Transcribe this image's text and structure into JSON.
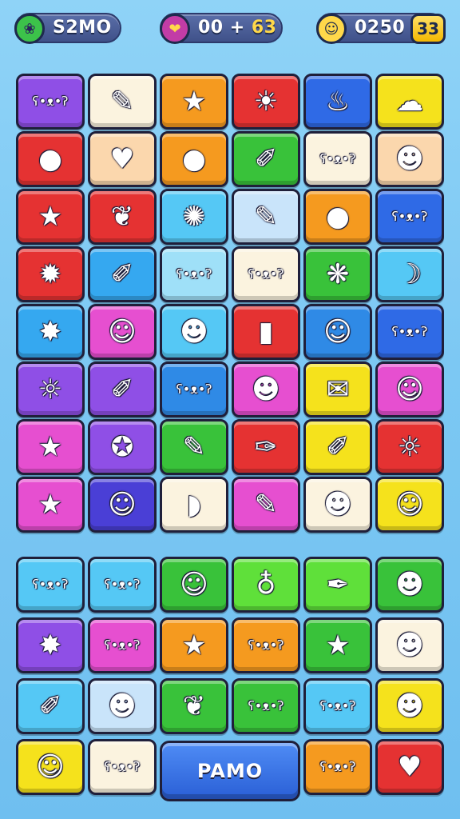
{
  "hud": {
    "coins": {
      "icon": "leaf-coin-icon",
      "value": "S2MO",
      "color": "#3cc24a"
    },
    "moves": {
      "icon": "heart-ribbon-icon",
      "value": "00 + ",
      "accent": "63",
      "color": "#c23ca6"
    },
    "score": {
      "icon": "smiley-icon",
      "value": "0250",
      "badge": "33",
      "color": "#ffd84a"
    }
  },
  "board_top": {
    "rows": [
      [
        {
          "color": "#8f4fe6",
          "glyph": "bear-face-icon"
        },
        {
          "color": "#fbf3df",
          "glyph": "pencil-icon"
        },
        {
          "color": "#f59a1f",
          "glyph": "star-icon"
        },
        {
          "color": "#e53232",
          "glyph": "lion-face-icon"
        },
        {
          "color": "#2f6ae6",
          "glyph": "chili-pepper-icon"
        },
        {
          "color": "#f5e21c",
          "glyph": "ghost-icon"
        }
      ],
      [
        {
          "color": "#e53232",
          "glyph": "fruit-face-icon"
        },
        {
          "color": "#fbd7ad",
          "glyph": "heart-icon"
        },
        {
          "color": "#f59a1f",
          "glyph": "apple-icon"
        },
        {
          "color": "#39c23a",
          "glyph": "crayon-icon"
        },
        {
          "color": "#fbf3df",
          "glyph": "bear-face-icon"
        },
        {
          "color": "#fbd7ad",
          "glyph": "monster-face-icon"
        }
      ],
      [
        {
          "color": "#e53232",
          "glyph": "star-icon"
        },
        {
          "color": "#e53232",
          "glyph": "leaf-icon"
        },
        {
          "color": "#55c8f5",
          "glyph": "yarn-ball-icon"
        },
        {
          "color": "#c9e4fa",
          "glyph": "pencil-icon"
        },
        {
          "color": "#f59a1f",
          "glyph": "cookie-face-icon"
        },
        {
          "color": "#2f6ae6",
          "glyph": "bear-face-icon"
        }
      ],
      [
        {
          "color": "#e53232",
          "glyph": "bomb-icon"
        },
        {
          "color": "#35a8f0",
          "glyph": "crayon-icon"
        },
        {
          "color": "#9fe0f8",
          "glyph": "bear-face-icon"
        },
        {
          "color": "#fbf3df",
          "glyph": "bear-face-icon"
        },
        {
          "color": "#39c23a",
          "glyph": "splash-icon"
        },
        {
          "color": "#55c8f5",
          "glyph": "banana-icon"
        }
      ],
      [
        {
          "color": "#35a8f0",
          "glyph": "splat-icon"
        },
        {
          "color": "#e64fd0",
          "glyph": "hamster-face-icon"
        },
        {
          "color": "#55c8f5",
          "glyph": "blob-face-icon"
        },
        {
          "color": "#e53232",
          "glyph": "battery-icon"
        },
        {
          "color": "#2f8ae6",
          "glyph": "orange-face-icon"
        },
        {
          "color": "#2f6ae6",
          "glyph": "bear-face-icon"
        }
      ],
      [
        {
          "color": "#8f4fe6",
          "glyph": "sun-face-icon"
        },
        {
          "color": "#8f4fe6",
          "glyph": "crayon-icon"
        },
        {
          "color": "#2f8ae6",
          "glyph": "bear-face-icon"
        },
        {
          "color": "#e64fd0",
          "glyph": "whale-face-icon"
        },
        {
          "color": "#f5e21c",
          "glyph": "envelope-icon"
        },
        {
          "color": "#e64fd0",
          "glyph": "cat-face-icon"
        }
      ],
      [
        {
          "color": "#e64fd0",
          "glyph": "star-icon"
        },
        {
          "color": "#8f4fe6",
          "glyph": "star-face-icon"
        },
        {
          "color": "#39c23a",
          "glyph": "pencil-icon"
        },
        {
          "color": "#e53232",
          "glyph": "sparkle-pencil-icon"
        },
        {
          "color": "#f5e21c",
          "glyph": "crayon-icon"
        },
        {
          "color": "#e53232",
          "glyph": "sun-face-icon"
        }
      ],
      [
        {
          "color": "#e64fd0",
          "glyph": "star-icon"
        },
        {
          "color": "#4a3fd6",
          "glyph": "cat-face-icon"
        },
        {
          "color": "#fbf3df",
          "glyph": "pac-face-icon"
        },
        {
          "color": "#e64fd0",
          "glyph": "pencil-icon"
        },
        {
          "color": "#fbf3df",
          "glyph": "tomato-face-icon"
        },
        {
          "color": "#f5e21c",
          "glyph": "hamster-face-icon"
        }
      ]
    ]
  },
  "board_bottom": {
    "rows": [
      [
        {
          "color": "#55c8f5",
          "glyph": "bear-face-icon"
        },
        {
          "color": "#55c8f5",
          "glyph": "bear-face-icon"
        },
        {
          "color": "#39c23a",
          "glyph": "chat-face-icon"
        },
        {
          "color": "#5fe03a",
          "glyph": "balloon-icon"
        },
        {
          "color": "#5fe03a",
          "glyph": "brush-icon"
        },
        {
          "color": "#39c23a",
          "glyph": "blob-face-icon"
        }
      ],
      [
        {
          "color": "#8f4fe6",
          "glyph": "splat-icon"
        },
        {
          "color": "#e64fd0",
          "glyph": "bear-face-icon"
        },
        {
          "color": "#f59a1f",
          "glyph": "star-icon"
        },
        {
          "color": "#f59a1f",
          "glyph": "bear-face-icon"
        },
        {
          "color": "#39c23a",
          "glyph": "star-icon"
        },
        {
          "color": "#fbf3df",
          "glyph": "tomato-face-icon"
        }
      ],
      [
        {
          "color": "#55c8f5",
          "glyph": "crayon-icon"
        },
        {
          "color": "#c9e4fa",
          "glyph": "frog-face-icon"
        },
        {
          "color": "#39c23a",
          "glyph": "leaf-icon"
        },
        {
          "color": "#39c23a",
          "glyph": "bear-face-icon"
        },
        {
          "color": "#55c8f5",
          "glyph": "bear-face-icon"
        },
        {
          "color": "#f5e21c",
          "glyph": "tomato-face-icon"
        }
      ],
      [
        {
          "color": "#f5e21c",
          "glyph": "orange-face-icon"
        },
        {
          "color": "#fbf3df",
          "glyph": "bear-face-icon"
        },
        {
          "color": "#f59a1f",
          "glyph": "bear-face-icon"
        },
        {
          "color": "#e53232",
          "glyph": "heart-icon"
        }
      ]
    ],
    "play_label": "PAMO"
  }
}
